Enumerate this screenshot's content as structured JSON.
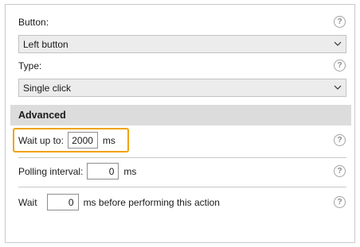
{
  "button": {
    "label": "Button:",
    "selected": "Left button"
  },
  "type": {
    "label": "Type:",
    "selected": "Single click"
  },
  "advanced": {
    "header": "Advanced",
    "wait_up_to": {
      "label": "Wait up to:",
      "value": "2000",
      "unit": "ms"
    },
    "polling_interval": {
      "label": "Polling interval:",
      "value": "0",
      "unit": "ms"
    },
    "wait_before": {
      "label": "Wait",
      "value": "0",
      "suffix": "ms before performing this action"
    }
  },
  "help_glyph": "?",
  "colors": {
    "highlight": "#f0a30a",
    "section_header_bg": "#dcdcdc",
    "dropdown_bg": "#ececec"
  },
  "icons": [
    "help-icon",
    "chevron-down-icon"
  ]
}
